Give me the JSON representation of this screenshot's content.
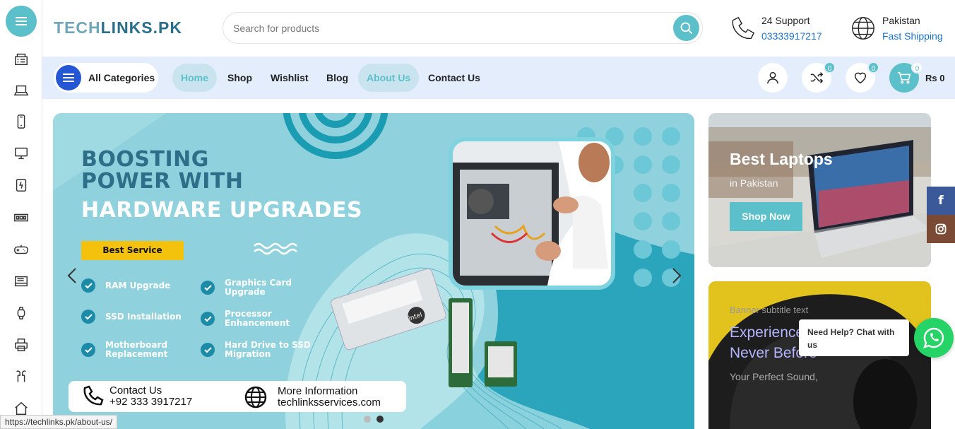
{
  "header": {
    "logo_text_a": "TECH",
    "logo_text_b": "LINKS.PK",
    "search_placeholder": "Search for products",
    "support_label": "24 Support",
    "support_phone": "03333917217",
    "region_label": "Pakistan",
    "region_sub": "Fast Shipping"
  },
  "nav": {
    "all_categories": "All Categories",
    "links": [
      "Home",
      "Shop",
      "Wishlist",
      "Blog",
      "About Us",
      "Contact Us"
    ],
    "compare_count": "0",
    "wishlist_count": "0",
    "cart_count": "0",
    "cart_total": "Rs 0"
  },
  "hero": {
    "title_line1": "BOOSTING",
    "title_line2": "POWER WITH",
    "title_line3": "HARDWARE UPGRADES",
    "best_service": "Best Service",
    "features": [
      [
        "RAM Upgrade",
        ""
      ],
      [
        "Graphics Card",
        "Upgrade"
      ],
      [
        "SSD Installation",
        ""
      ],
      [
        "Processor",
        "Enhancement"
      ],
      [
        "Motherboard",
        "Replacement"
      ],
      [
        "Hard Drive to SSD",
        "Migration"
      ]
    ],
    "contact_label": "Contact Us",
    "contact_phone": "+92 333 3917217",
    "info_label": "More Information",
    "info_site": "techlinksservices.com"
  },
  "banner1": {
    "title": "Best Laptops",
    "subtitle": "in Pakistan",
    "button": "Shop Now"
  },
  "banner2": {
    "subtitle": "Banner subtitle text",
    "title_line1": "Experience",
    "title_line2": "Never Before",
    "tagline": "Your Perfect Sound,"
  },
  "chat": {
    "text": "Need Help? Chat with us"
  },
  "status_url": "https://techlinks.pk/about-us/",
  "colors": {
    "accent": "#5bc0c9",
    "nav_bg": "#e3edfc",
    "brand_blue": "#2556d4",
    "whatsapp": "#25d366"
  },
  "icons": {
    "rail": [
      "menu-icon",
      "server-icon",
      "laptop-icon",
      "mobile-icon",
      "monitor-icon",
      "component-icon",
      "ram-icon",
      "gamepad-icon",
      "storage-icon",
      "smartwatch-icon",
      "printer-icon",
      "earbuds-icon",
      "home-icon"
    ]
  }
}
